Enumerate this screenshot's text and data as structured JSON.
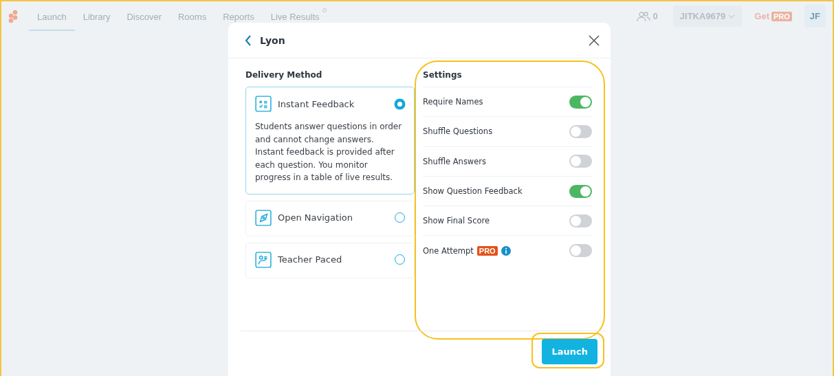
{
  "nav": {
    "tabs": [
      {
        "label": "Launch",
        "selected": true
      },
      {
        "label": "Library",
        "selected": false
      },
      {
        "label": "Discover",
        "selected": false
      },
      {
        "label": "Rooms",
        "selected": false
      },
      {
        "label": "Reports",
        "selected": false
      },
      {
        "label": "Live Results",
        "selected": false
      }
    ],
    "students_count": "0",
    "user_menu": "JITKA9679",
    "get": "Get",
    "pro": "PRO",
    "avatar": "JF"
  },
  "dialog": {
    "title": "Lyon",
    "delivery": {
      "heading": "Delivery Method",
      "methods": [
        {
          "kind": "instant",
          "label": "Instant Feedback",
          "selected": true,
          "description": "Students answer questions in order and cannot change answers. Instant feedback is provided after each question. You monitor progress in a table of live results."
        },
        {
          "kind": "navigation",
          "label": "Open Navigation",
          "selected": false
        },
        {
          "kind": "teacher",
          "label": "Teacher Paced",
          "selected": false
        }
      ]
    },
    "settings": {
      "heading": "Settings",
      "items": [
        {
          "label": "Require Names",
          "on": true
        },
        {
          "label": "Shuffle Questions",
          "on": false
        },
        {
          "label": "Shuffle Answers",
          "on": false
        },
        {
          "label": "Show Question Feedback",
          "on": true
        },
        {
          "label": "Show Final Score",
          "on": false
        },
        {
          "label": "One Attempt",
          "on": false,
          "badge": "PRO",
          "info": true
        }
      ]
    },
    "launch_button": "Launch"
  }
}
